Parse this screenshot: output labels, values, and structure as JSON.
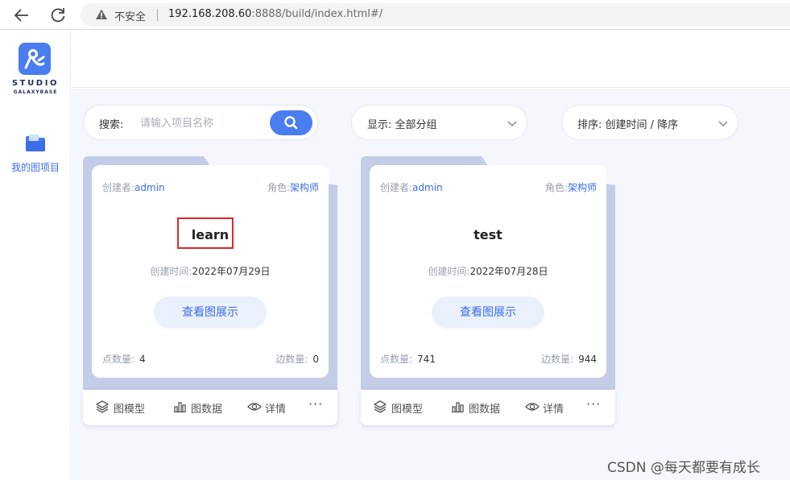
{
  "browser": {
    "security_label": "不安全",
    "url_host": "192.168.208.60",
    "url_rest": ":8888/build/index.html#/"
  },
  "sidebar": {
    "logo_text": "STUDIO",
    "logo_sub": "GALAXYBASE",
    "items": [
      {
        "label": "我的图项目",
        "icon": "folder-icon"
      }
    ]
  },
  "toolbar": {
    "search_label": "搜索:",
    "search_placeholder": "请输入项目名称",
    "group_label": "显示: 全部分组",
    "sort_label": "排序: 创建时间 / 降序"
  },
  "cards": [
    {
      "creator_label": "创建者:",
      "creator": "admin",
      "role_label": "角色:",
      "role": "架构师",
      "name": "learn",
      "created_label": "创建时间:",
      "created": "2022年07月29日",
      "view_label": "查看图展示",
      "nodes_label": "点数量:",
      "nodes": "4",
      "edges_label": "边数量:",
      "edges": "0",
      "actions": {
        "model": "图模型",
        "data": "图数据",
        "detail": "详情",
        "more": "···"
      }
    },
    {
      "creator_label": "创建者:",
      "creator": "admin",
      "role_label": "角色:",
      "role": "架构师",
      "name": "test",
      "created_label": "创建时间:",
      "created": "2022年07月28日",
      "view_label": "查看图展示",
      "nodes_label": "点数量:",
      "nodes": "741",
      "edges_label": "边数量:",
      "edges": "944",
      "actions": {
        "model": "图模型",
        "data": "图数据",
        "detail": "详情",
        "more": "···"
      }
    }
  ],
  "watermark": "CSDN @每天都要有成长",
  "colors": {
    "accent": "#4a7df0",
    "card_back": "#c3cde8",
    "highlight": "#e0262b"
  }
}
